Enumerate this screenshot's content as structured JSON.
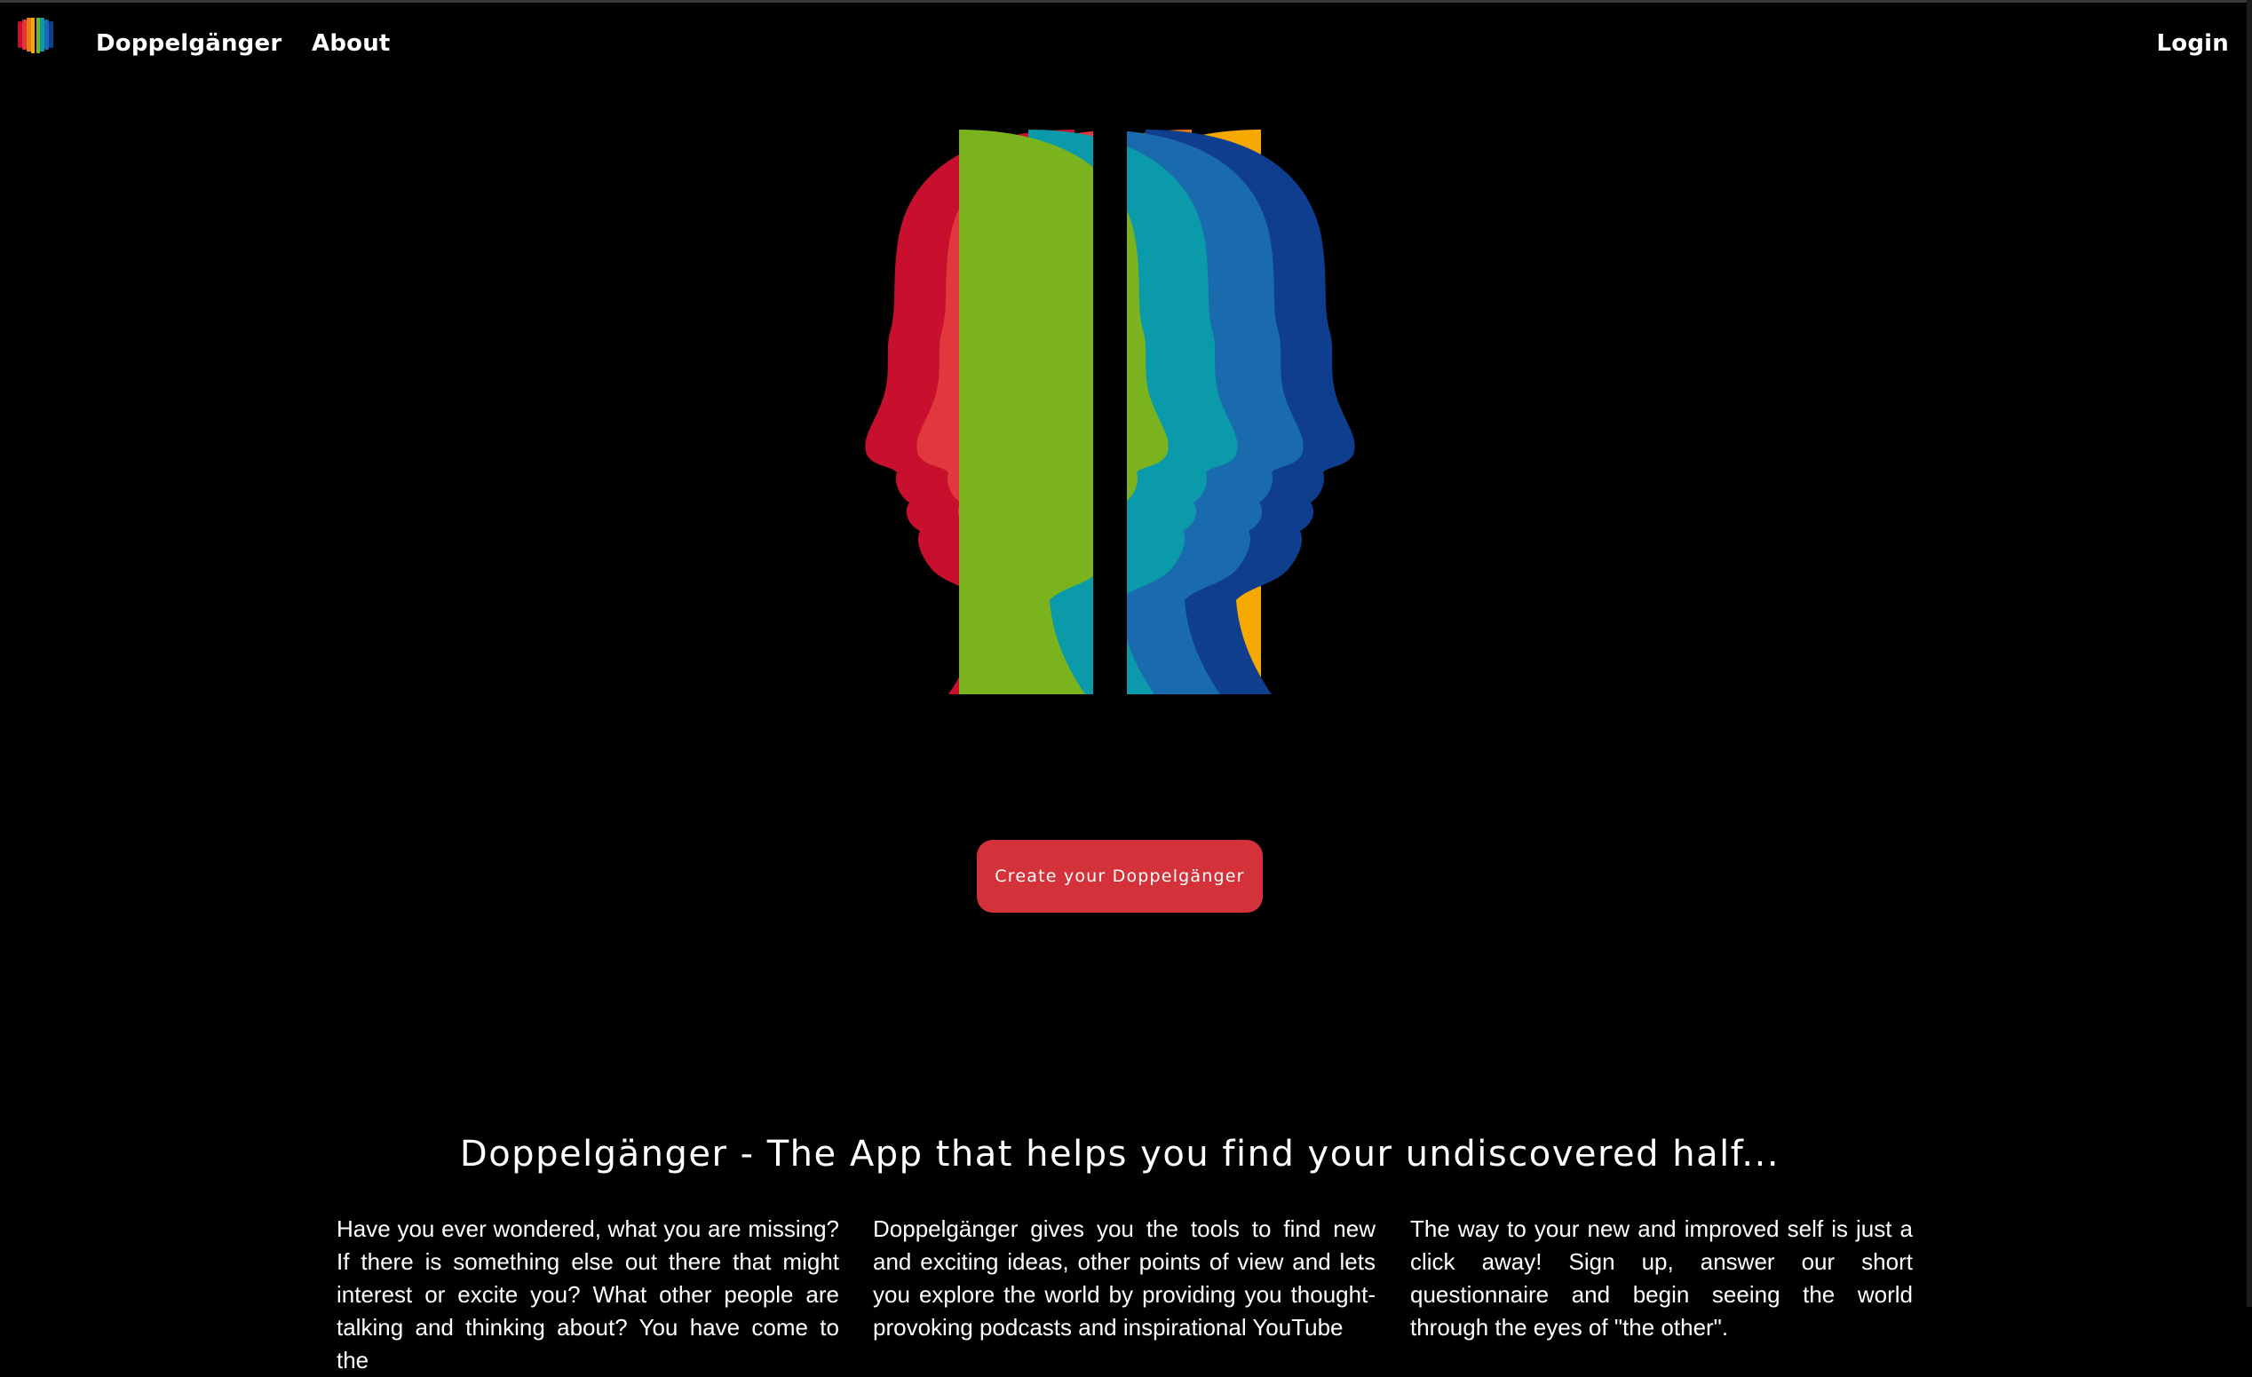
{
  "navbar": {
    "logo_icon": "rainbow-heads-logo-icon",
    "brand": "Doppelgänger",
    "about": "About",
    "login": "Login"
  },
  "hero": {
    "image": "rainbow-twin-head-silhouettes",
    "left_colors": [
      "#c8102e",
      "#e2373d",
      "#ea7d12",
      "#f5a800"
    ],
    "right_colors": [
      "#7bb31f",
      "#0b9aaa",
      "#1a6aae",
      "#0f3e8f"
    ]
  },
  "cta": {
    "label": "Create your Doppelgänger",
    "color": "#d3323a"
  },
  "headline": "Doppelgänger - The App that helps you find your undiscovered half...",
  "columns": [
    "Have you ever wondered, what you are missing? If there is something else out there that might interest or excite you? What other people are talking and thinking about? You have come to the",
    "Doppelgänger gives you the tools to find new and exciting ideas, other points of view and lets you explore the world by providing you thought-provoking podcasts and inspirational YouTube",
    "The way to your new and improved self is just a click away! Sign up, answer our short questionnaire and begin seeing the world through the eyes of \"the other\"."
  ]
}
